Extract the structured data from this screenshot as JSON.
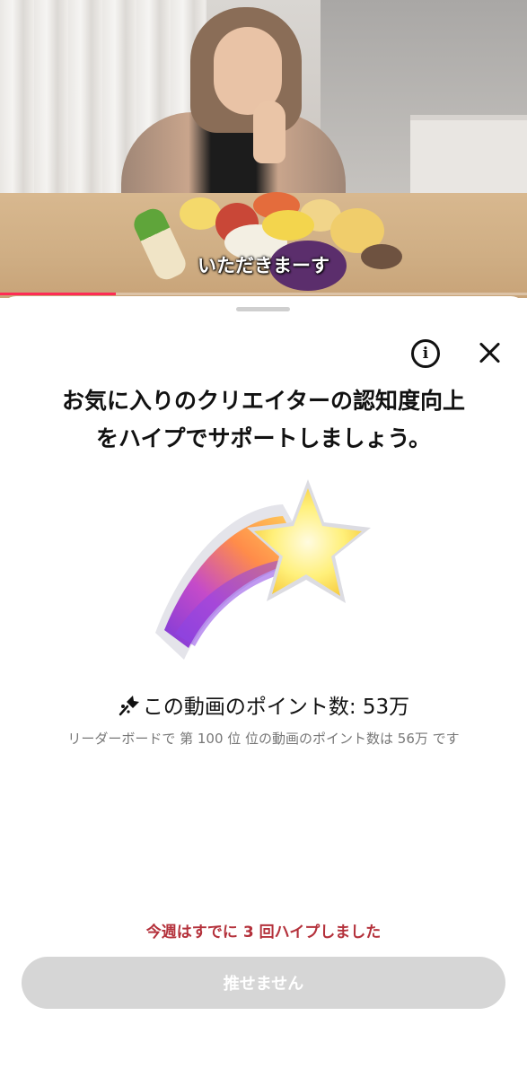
{
  "video": {
    "subtitle": "いただきまーす",
    "progress": 0.22,
    "accent_color": "#fe2c55"
  },
  "sheet": {
    "info_icon": "info-circle-icon",
    "close_icon": "close-x-icon",
    "headline_line1": "お気に入りのクリエイターの認知度向上",
    "headline_line2": "をハイプでサポートしましょう。",
    "illustration_icon": "shooting-star-icon",
    "points_icon": "pin-icon",
    "points_text": "この動画のポイント数: 53万",
    "leaderboard_text": "リーダーボードで 第 100 位 位の動画のポイント数は 56万 です",
    "hyped_text": "今週はすでに 3 回ハイプしました",
    "hyped_color": "#b4313b",
    "button_label": "推せません",
    "button_color": "#d6d6d6"
  }
}
